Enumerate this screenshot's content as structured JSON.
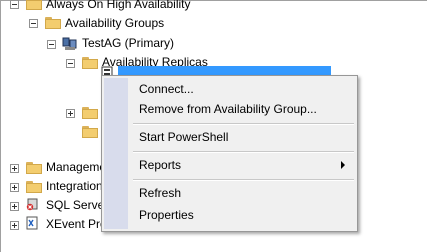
{
  "tree": {
    "always_on": "Always On High Availability",
    "availability_groups": "Availability Groups",
    "testag": "TestAG (Primary)",
    "availability_replicas": "Availability Replicas",
    "selected_replica": "",
    "management": "Manageme",
    "integration": "Integration",
    "sql_server": "SQL Server",
    "xevent": "XEvent Pro"
  },
  "context_menu": {
    "items": [
      {
        "label": "Connect..."
      },
      {
        "label": "Remove from Availability Group..."
      },
      {
        "label": "Start PowerShell"
      },
      {
        "label": "Reports"
      },
      {
        "label": "Refresh"
      },
      {
        "label": "Properties"
      }
    ]
  },
  "colors": {
    "selection": "#3399ff",
    "folder": "#f3cd6f",
    "menu_bg": "#f0f0f0"
  }
}
